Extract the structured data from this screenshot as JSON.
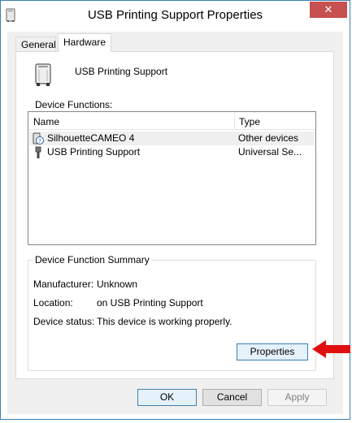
{
  "window": {
    "title": "USB Printing Support Properties",
    "close_glyph": "✕",
    "icon": "printer-icon"
  },
  "tabs": [
    {
      "label": "General",
      "selected": false
    },
    {
      "label": "Hardware",
      "selected": true
    }
  ],
  "device": {
    "name": "USB Printing Support",
    "icon": "printer-icon"
  },
  "functions": {
    "label": "Device Functions:",
    "columns": [
      "Name",
      "Type"
    ],
    "rows": [
      {
        "name": "SilhouetteCAMEO 4",
        "type": "Other devices",
        "icon": "unknown-device-icon"
      },
      {
        "name": "USB Printing Support",
        "type": "Universal Se...",
        "icon": "usb-icon"
      }
    ]
  },
  "summary": {
    "legend": "Device Function Summary",
    "manufacturer_label": "Manufacturer:",
    "manufacturer_value": "Unknown",
    "location_label": "Location:",
    "location_value": "on USB Printing Support",
    "status_label": "Device status:",
    "status_value": "This device is working properly.",
    "properties_button": "Properties"
  },
  "buttons": {
    "ok": "OK",
    "cancel": "Cancel",
    "apply": "Apply"
  },
  "colors": {
    "accent": "#3c7fb1",
    "close": "#c75050",
    "annotation_arrow": "#e01010"
  }
}
